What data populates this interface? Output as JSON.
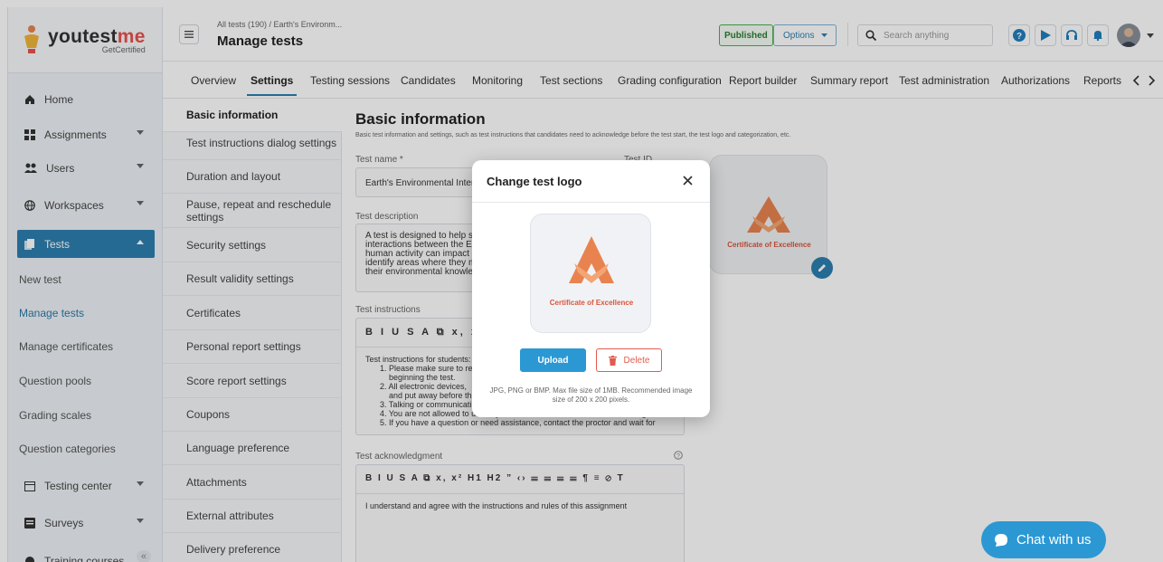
{
  "brand": {
    "name_a": "youtest",
    "name_b": "me",
    "tagline": "GetCertified"
  },
  "sidebar": {
    "home": "Home",
    "assignments": "Assignments",
    "users": "Users",
    "workspaces": "Workspaces",
    "tests": "Tests",
    "sub": [
      "New test",
      "Manage tests",
      "Manage certificates",
      "Question pools",
      "Grading scales",
      "Question categories"
    ],
    "testing_center": "Testing center",
    "surveys": "Surveys",
    "training_courses": "Training courses"
  },
  "header": {
    "breadcrumb": "All tests (190)  /  Earth's Environm...",
    "title": "Manage tests",
    "published": "Published",
    "options": "Options",
    "search_placeholder": "Search anything"
  },
  "tabs": [
    "Overview",
    "Settings",
    "Testing sessions",
    "Candidates",
    "Monitoring",
    "Test sections",
    "Grading configuration",
    "Report builder",
    "Summary report",
    "Test administration",
    "Authorizations",
    "Reports"
  ],
  "settings_menu": [
    "Basic information",
    "Test instructions dialog settings",
    "Duration and layout",
    "Pause, repeat and reschedule settings",
    "Security settings",
    "Result validity settings",
    "Certificates",
    "Personal report settings",
    "Score report settings",
    "Coupons",
    "Language preference",
    "Attachments",
    "External attributes",
    "Delivery preference"
  ],
  "main": {
    "title": "Basic information",
    "subtitle": "Basic test information and settings, such as test instructions that candidates need to acknowledge before the test start, the test logo and categorization, etc.",
    "test_name_label": "Test name *",
    "test_name_value": "Earth's Environmental Intera",
    "test_id_label": "Test ID",
    "description_label": "Test description",
    "description_lines": [
      "A test is designed to help st",
      "interactions between the Ea",
      "human activity can impact t",
      "identify areas where they m",
      "their environmental knowled"
    ],
    "instructions_label": "Test instructions",
    "instructions_head": "Test instructions for students:",
    "instructions_lines": [
      "1. Please make sure to re",
      "beginning the test.",
      "2. All electronic devices,",
      "and put away before the",
      "3. Talking or communicating",
      "4. You are not allowed to use any outside materials or cheat sheets during the test.",
      "5. If you have a question or need assistance, contact the proctor and wait for"
    ],
    "acknowledgment_label": "Test acknowledgment",
    "acknowledgment_text": "I understand and agree with the instructions and rules of this assignment",
    "logo_caption": "Certificate of Excellence"
  },
  "modal": {
    "title": "Change test logo",
    "logo_caption": "Certificate of Excellence",
    "upload": "Upload",
    "delete": "Delete",
    "hint": "JPG, PNG or BMP. Max file size of 1MB. Recommended image size of 200 x 200 pixels."
  },
  "chat": {
    "label": "Chat with us"
  },
  "colors": {
    "accent": "#2d7fb0",
    "logo_orange": "#e8834f",
    "delete_red": "#e25b4e",
    "chat": "#2b98d4"
  }
}
